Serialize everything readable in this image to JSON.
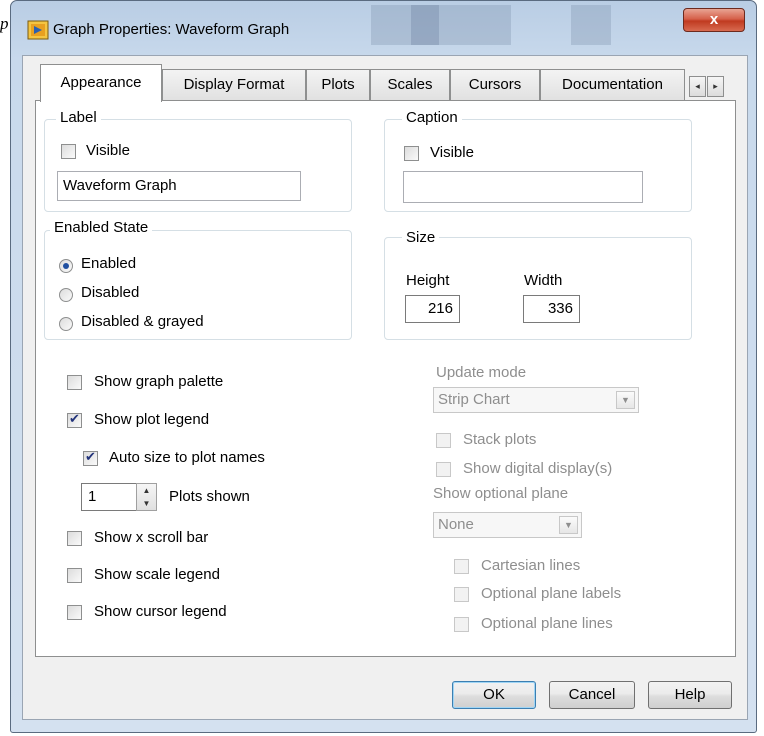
{
  "stray_glyph": "p",
  "window": {
    "title": "Graph Properties: Waveform Graph",
    "close_symbol": "x"
  },
  "tabs": [
    "Appearance",
    "Display Format",
    "Plots",
    "Scales",
    "Cursors",
    "Documentation"
  ],
  "tab_scroll": {
    "left": "◂",
    "right": "▸"
  },
  "label_group": {
    "title": "Label",
    "visible_label": "Visible",
    "visible_checked": false,
    "text_value": "Waveform Graph"
  },
  "caption_group": {
    "title": "Caption",
    "visible_label": "Visible",
    "visible_checked": false,
    "text_value": ""
  },
  "enabled_state": {
    "title": "Enabled State",
    "options": [
      "Enabled",
      "Disabled",
      "Disabled & grayed"
    ],
    "selected": "Enabled"
  },
  "size_group": {
    "title": "Size",
    "height_label": "Height",
    "width_label": "Width",
    "height_value": "216",
    "width_value": "336"
  },
  "options_left": {
    "show_graph_palette": {
      "label": "Show graph palette",
      "checked": false
    },
    "show_plot_legend": {
      "label": "Show plot legend",
      "checked": true
    },
    "auto_size": {
      "label": "Auto size to plot names",
      "checked": true
    },
    "plots_shown": {
      "value": "1",
      "label": "Plots shown"
    },
    "show_x_scroll": {
      "label": "Show x scroll bar",
      "checked": false
    },
    "show_scale_legend": {
      "label": "Show scale legend",
      "checked": false
    },
    "show_cursor_legend": {
      "label": "Show cursor legend",
      "checked": false
    }
  },
  "options_right": {
    "update_mode_label": "Update mode",
    "update_mode_value": "Strip Chart",
    "stack_plots": "Stack plots",
    "show_digital_display": "Show digital display(s)",
    "optional_plane_label": "Show optional plane",
    "optional_plane_value": "None",
    "cartesian_lines": "Cartesian lines",
    "optional_plane_labels": "Optional plane labels",
    "optional_plane_lines": "Optional plane lines"
  },
  "buttons": {
    "ok": "OK",
    "cancel": "Cancel",
    "help": "Help"
  },
  "colors": {
    "title_bar": "#c8d9ec",
    "close_button": "#c9452b",
    "panel": "#ffffff",
    "disabled_text": "#8e8e8e"
  }
}
